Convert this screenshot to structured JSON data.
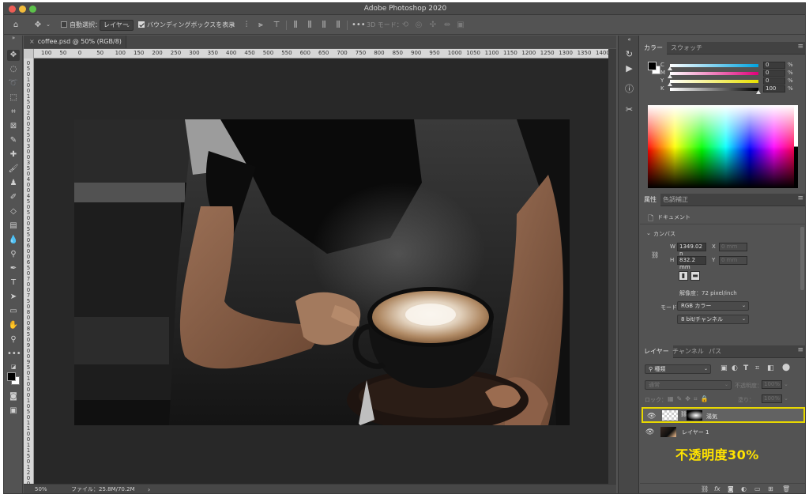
{
  "window": {
    "title": "Adobe Photoshop 2020"
  },
  "options_bar": {
    "auto_select_label": "自動選択：",
    "auto_select_target": "レイヤー",
    "bounding_box_label": "バウンディングボックスを表示",
    "mode_3d_label": "3D モード："
  },
  "document": {
    "tab_label": "coffee.psd @ 50% (RGB/8) *",
    "zoom": "50%",
    "file_info": "ファイル：25.8M/70.2M",
    "ruler_top": [
      "100",
      "50",
      "0",
      "50",
      "100",
      "150",
      "200",
      "250",
      "300",
      "350",
      "400",
      "450",
      "500",
      "550",
      "600",
      "650",
      "700",
      "750",
      "800",
      "850",
      "900",
      "950",
      "1000",
      "1050",
      "1100",
      "1150",
      "1200",
      "1250",
      "1300",
      "1350",
      "1400"
    ],
    "ruler_left": [
      "0",
      "5",
      "0",
      "1",
      "0",
      "0",
      "1",
      "5",
      "0",
      "2",
      "0",
      "0",
      "2",
      "5",
      "0",
      "3",
      "0",
      "0",
      "3",
      "5",
      "0",
      "4",
      "0",
      "0",
      "4",
      "5",
      "0",
      "5",
      "0",
      "0",
      "5",
      "5",
      "0",
      "6",
      "0",
      "0",
      "6",
      "5",
      "0",
      "7",
      "0",
      "0",
      "7",
      "5",
      "0",
      "8",
      "0",
      "0",
      "8",
      "5",
      "0",
      "9",
      "0",
      "0",
      "9",
      "5",
      "0",
      "1",
      "0",
      "0",
      "0",
      "1",
      "0",
      "5",
      "0",
      "1",
      "1",
      "0",
      "0",
      "1",
      "1",
      "5",
      "0",
      "1",
      "2",
      "0",
      "0"
    ]
  },
  "color_panel": {
    "tabs": [
      "カラー",
      "スウォッチ"
    ],
    "sliders": [
      {
        "label": "C",
        "value": "0",
        "unit": "%",
        "pos": 0.0,
        "color": "#00a3e0"
      },
      {
        "label": "M",
        "value": "0",
        "unit": "%",
        "pos": 0.0,
        "color": "#e0007a"
      },
      {
        "label": "Y",
        "value": "0",
        "unit": "%",
        "pos": 0.0,
        "color": "#e8e000"
      },
      {
        "label": "K",
        "value": "100",
        "unit": "%",
        "pos": 1.0,
        "color": "#000000"
      }
    ]
  },
  "properties_panel": {
    "tabs": [
      "属性",
      "色調補正"
    ],
    "doc_label": "ドキュメント",
    "canvas_section": "カンバス",
    "width_label": "W",
    "width_value": "1349.02 n",
    "x_label": "X",
    "x_placeholder": "0 mm",
    "height_label": "H",
    "height_value": "832.2 mm",
    "y_label": "Y",
    "y_placeholder": "0 mm",
    "resolution": "解像度：72 pixel/inch",
    "mode_label": "モード",
    "mode_value": "RGB カラー",
    "depth_value": "8 bit/チャンネル"
  },
  "layers_panel": {
    "tabs": [
      "レイヤー",
      "チャンネル",
      "パス"
    ],
    "filter_kind": "種類",
    "blend_mode": "通常",
    "opacity_label": "不透明度：",
    "opacity_value": "100%",
    "lock_label": "ロック：",
    "fill_label": "塗り：",
    "fill_value": "100%",
    "layers": [
      {
        "name": "湯気",
        "selected": true,
        "highlight_color": "#e8d800"
      },
      {
        "name": "レイヤー 1",
        "selected": false
      }
    ]
  },
  "annotation": {
    "text": "不透明度30%",
    "color": "#ffe300"
  }
}
